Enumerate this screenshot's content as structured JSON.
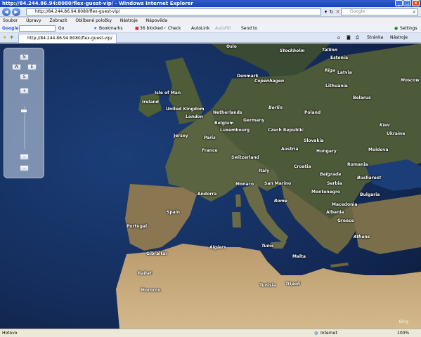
{
  "window": {
    "title": "http://84.244.86.94:8080/flex-guest-vip/ - Windows Internet Explorer",
    "buttons": [
      "_",
      "□",
      "×"
    ]
  },
  "address": {
    "url": "http://84.244.86.94:8080/flex-guest-vip/",
    "search_placeholder": "Google"
  },
  "menu": [
    "Soubor",
    "Úpravy",
    "Zobrazit",
    "Oblíbené položky",
    "Nástroje",
    "Nápověda"
  ],
  "google_toolbar": {
    "brand": "Google",
    "go_label": "Go",
    "bookmarks": "Bookmarks",
    "blocked": "36 blocked",
    "check": "Check",
    "autolink": "AutoLink",
    "autofill": "AutoFill",
    "sendto": "Send to",
    "settings": "Settings"
  },
  "tabs": {
    "active_label": "http://84.244.86.94:8080/flex-guest-vip/",
    "page_menu": "Stránka",
    "tools_menu": "Nástroje"
  },
  "map": {
    "controls": {
      "north": "N",
      "west": "W",
      "east": "E",
      "south": "S",
      "zoom_in": "+",
      "zoom_out": "-"
    },
    "labels": [
      {
        "text": "Oslo",
        "cls": ""
      },
      {
        "text": "Stockholm",
        "cls": "cap"
      },
      {
        "text": "Tallinn",
        "cls": "cap"
      },
      {
        "text": "Estonia",
        "cls": ""
      },
      {
        "text": "Riga",
        "cls": "cap"
      },
      {
        "text": "Latvia",
        "cls": ""
      },
      {
        "text": "Denmark",
        "cls": ""
      },
      {
        "text": "Copenhagen",
        "cls": "cap"
      },
      {
        "text": "Lithuania",
        "cls": ""
      },
      {
        "text": "Moscow",
        "cls": "cap"
      },
      {
        "text": "Belarus",
        "cls": ""
      },
      {
        "text": "Isle of Man",
        "cls": ""
      },
      {
        "text": "Ireland",
        "cls": ""
      },
      {
        "text": "United Kingdom",
        "cls": ""
      },
      {
        "text": "London",
        "cls": "cap"
      },
      {
        "text": "Netherlands",
        "cls": ""
      },
      {
        "text": "Berlin",
        "cls": "cap"
      },
      {
        "text": "Poland",
        "cls": ""
      },
      {
        "text": "Belgium",
        "cls": ""
      },
      {
        "text": "Germany",
        "cls": ""
      },
      {
        "text": "Luxembourg",
        "cls": ""
      },
      {
        "text": "Kiev",
        "cls": "cap"
      },
      {
        "text": "Ukraine",
        "cls": ""
      },
      {
        "text": "Jersey",
        "cls": ""
      },
      {
        "text": "Paris",
        "cls": "cap"
      },
      {
        "text": "Czech Republic",
        "cls": ""
      },
      {
        "text": "Slovakia",
        "cls": ""
      },
      {
        "text": "France",
        "cls": ""
      },
      {
        "text": "Austria",
        "cls": ""
      },
      {
        "text": "Hungary",
        "cls": ""
      },
      {
        "text": "Moldova",
        "cls": ""
      },
      {
        "text": "Switzerland",
        "cls": ""
      },
      {
        "text": "Croatia",
        "cls": ""
      },
      {
        "text": "Romania",
        "cls": ""
      },
      {
        "text": "Italy",
        "cls": ""
      },
      {
        "text": "Belgrade",
        "cls": "cap"
      },
      {
        "text": "Bucharest",
        "cls": "cap"
      },
      {
        "text": "Andorra",
        "cls": ""
      },
      {
        "text": "Monaco",
        "cls": ""
      },
      {
        "text": "San Marino",
        "cls": ""
      },
      {
        "text": "Serbia",
        "cls": ""
      },
      {
        "text": "Montenegro",
        "cls": ""
      },
      {
        "text": "Bulgaria",
        "cls": ""
      },
      {
        "text": "Rome",
        "cls": "cap"
      },
      {
        "text": "Macedonia",
        "cls": ""
      },
      {
        "text": "Spain",
        "cls": ""
      },
      {
        "text": "Albania",
        "cls": ""
      },
      {
        "text": "Portugal",
        "cls": ""
      },
      {
        "text": "Greece",
        "cls": ""
      },
      {
        "text": "Athens",
        "cls": "cap"
      },
      {
        "text": "Gibraltar",
        "cls": ""
      },
      {
        "text": "Algiers",
        "cls": "cap"
      },
      {
        "text": "Tunis",
        "cls": "cap"
      },
      {
        "text": "Malta",
        "cls": ""
      },
      {
        "text": "Rabat",
        "cls": "cap"
      },
      {
        "text": "Tripoli",
        "cls": "cap"
      },
      {
        "text": "Morocco",
        "cls": ""
      },
      {
        "text": "Tunisia",
        "cls": ""
      }
    ],
    "attribution": "Bing"
  },
  "status": {
    "left": "Hotovo",
    "zone": "Internet",
    "zoom": "100%"
  }
}
